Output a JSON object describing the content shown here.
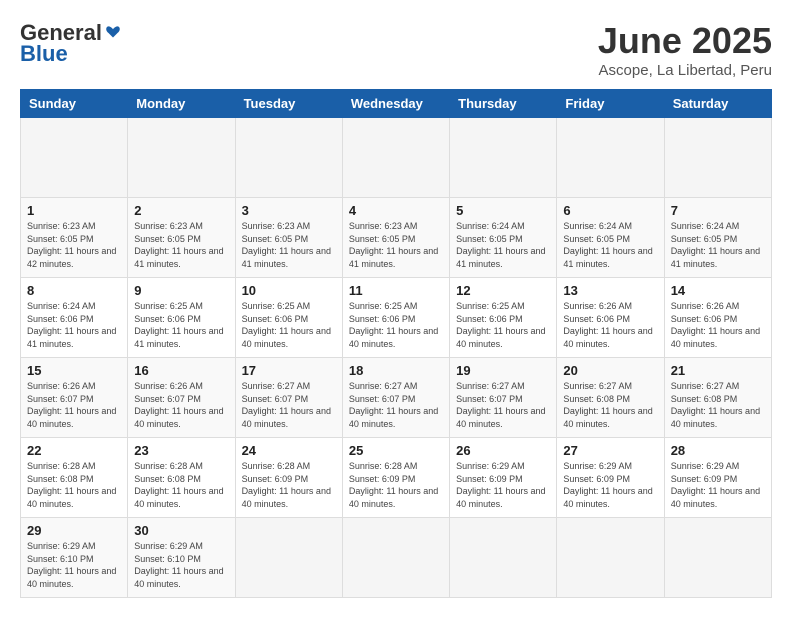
{
  "header": {
    "logo_general": "General",
    "logo_blue": "Blue",
    "title": "June 2025",
    "location": "Ascope, La Libertad, Peru"
  },
  "calendar": {
    "days_of_week": [
      "Sunday",
      "Monday",
      "Tuesday",
      "Wednesday",
      "Thursday",
      "Friday",
      "Saturday"
    ],
    "weeks": [
      [
        {
          "day": "",
          "empty": true
        },
        {
          "day": "",
          "empty": true
        },
        {
          "day": "",
          "empty": true
        },
        {
          "day": "",
          "empty": true
        },
        {
          "day": "",
          "empty": true
        },
        {
          "day": "",
          "empty": true
        },
        {
          "day": "",
          "empty": true
        }
      ],
      [
        {
          "day": "1",
          "sunrise": "6:23 AM",
          "sunset": "6:05 PM",
          "daylight": "11 hours and 42 minutes."
        },
        {
          "day": "2",
          "sunrise": "6:23 AM",
          "sunset": "6:05 PM",
          "daylight": "11 hours and 41 minutes."
        },
        {
          "day": "3",
          "sunrise": "6:23 AM",
          "sunset": "6:05 PM",
          "daylight": "11 hours and 41 minutes."
        },
        {
          "day": "4",
          "sunrise": "6:23 AM",
          "sunset": "6:05 PM",
          "daylight": "11 hours and 41 minutes."
        },
        {
          "day": "5",
          "sunrise": "6:24 AM",
          "sunset": "6:05 PM",
          "daylight": "11 hours and 41 minutes."
        },
        {
          "day": "6",
          "sunrise": "6:24 AM",
          "sunset": "6:05 PM",
          "daylight": "11 hours and 41 minutes."
        },
        {
          "day": "7",
          "sunrise": "6:24 AM",
          "sunset": "6:05 PM",
          "daylight": "11 hours and 41 minutes."
        }
      ],
      [
        {
          "day": "8",
          "sunrise": "6:24 AM",
          "sunset": "6:06 PM",
          "daylight": "11 hours and 41 minutes."
        },
        {
          "day": "9",
          "sunrise": "6:25 AM",
          "sunset": "6:06 PM",
          "daylight": "11 hours and 41 minutes."
        },
        {
          "day": "10",
          "sunrise": "6:25 AM",
          "sunset": "6:06 PM",
          "daylight": "11 hours and 40 minutes."
        },
        {
          "day": "11",
          "sunrise": "6:25 AM",
          "sunset": "6:06 PM",
          "daylight": "11 hours and 40 minutes."
        },
        {
          "day": "12",
          "sunrise": "6:25 AM",
          "sunset": "6:06 PM",
          "daylight": "11 hours and 40 minutes."
        },
        {
          "day": "13",
          "sunrise": "6:26 AM",
          "sunset": "6:06 PM",
          "daylight": "11 hours and 40 minutes."
        },
        {
          "day": "14",
          "sunrise": "6:26 AM",
          "sunset": "6:06 PM",
          "daylight": "11 hours and 40 minutes."
        }
      ],
      [
        {
          "day": "15",
          "sunrise": "6:26 AM",
          "sunset": "6:07 PM",
          "daylight": "11 hours and 40 minutes."
        },
        {
          "day": "16",
          "sunrise": "6:26 AM",
          "sunset": "6:07 PM",
          "daylight": "11 hours and 40 minutes."
        },
        {
          "day": "17",
          "sunrise": "6:27 AM",
          "sunset": "6:07 PM",
          "daylight": "11 hours and 40 minutes."
        },
        {
          "day": "18",
          "sunrise": "6:27 AM",
          "sunset": "6:07 PM",
          "daylight": "11 hours and 40 minutes."
        },
        {
          "day": "19",
          "sunrise": "6:27 AM",
          "sunset": "6:07 PM",
          "daylight": "11 hours and 40 minutes."
        },
        {
          "day": "20",
          "sunrise": "6:27 AM",
          "sunset": "6:08 PM",
          "daylight": "11 hours and 40 minutes."
        },
        {
          "day": "21",
          "sunrise": "6:27 AM",
          "sunset": "6:08 PM",
          "daylight": "11 hours and 40 minutes."
        }
      ],
      [
        {
          "day": "22",
          "sunrise": "6:28 AM",
          "sunset": "6:08 PM",
          "daylight": "11 hours and 40 minutes."
        },
        {
          "day": "23",
          "sunrise": "6:28 AM",
          "sunset": "6:08 PM",
          "daylight": "11 hours and 40 minutes."
        },
        {
          "day": "24",
          "sunrise": "6:28 AM",
          "sunset": "6:09 PM",
          "daylight": "11 hours and 40 minutes."
        },
        {
          "day": "25",
          "sunrise": "6:28 AM",
          "sunset": "6:09 PM",
          "daylight": "11 hours and 40 minutes."
        },
        {
          "day": "26",
          "sunrise": "6:29 AM",
          "sunset": "6:09 PM",
          "daylight": "11 hours and 40 minutes."
        },
        {
          "day": "27",
          "sunrise": "6:29 AM",
          "sunset": "6:09 PM",
          "daylight": "11 hours and 40 minutes."
        },
        {
          "day": "28",
          "sunrise": "6:29 AM",
          "sunset": "6:09 PM",
          "daylight": "11 hours and 40 minutes."
        }
      ],
      [
        {
          "day": "29",
          "sunrise": "6:29 AM",
          "sunset": "6:10 PM",
          "daylight": "11 hours and 40 minutes."
        },
        {
          "day": "30",
          "sunrise": "6:29 AM",
          "sunset": "6:10 PM",
          "daylight": "11 hours and 40 minutes."
        },
        {
          "day": "",
          "empty": true
        },
        {
          "day": "",
          "empty": true
        },
        {
          "day": "",
          "empty": true
        },
        {
          "day": "",
          "empty": true
        },
        {
          "day": "",
          "empty": true
        }
      ]
    ]
  }
}
